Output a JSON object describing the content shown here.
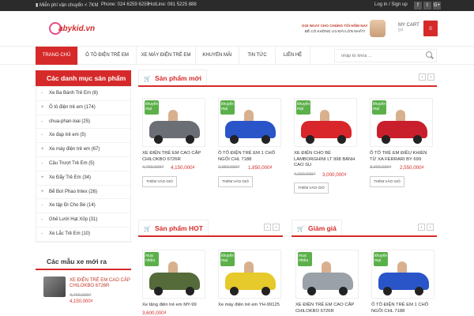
{
  "topbar": {
    "shipping": "Miễn phí vận chuyển < 7KM",
    "phone": "Phone: 024 6259 6259",
    "hotline": "HotLine: 081 5225 888",
    "account": "Log in / Sign up",
    "social": [
      "f",
      "t",
      "G+"
    ]
  },
  "header": {
    "logo_text": "abykid.vn",
    "promo_line1": "GỌI NGAY CHO CHÚNG TÔI HÔM NAY",
    "promo_line2": "ĐỂ CÓ KHÔNG ƯU ĐÃI LỚN NHẤT!",
    "cart_label": "MY CART",
    "cart_amount": "0₫",
    "cart_count": "0"
  },
  "nav": {
    "items": [
      "TRANG CHỦ",
      "Ô TÔ ĐIỆN TRẺ EM",
      "XE MÁY ĐIỆN TRẺ EM",
      "KHUYẾN MÃI",
      "TIN TỨC",
      "LIÊN HỆ"
    ],
    "search_placeholder": "nhập từ khóa ..."
  },
  "sidebar": {
    "categories_title": "Các danh mục sản phẩm",
    "categories": [
      {
        "bullet": "-",
        "label": "Xe Ba Bánh Trẻ Em (6)"
      },
      {
        "bullet": "+",
        "label": "Ô tô điện trẻ em (174)"
      },
      {
        "bullet": "-",
        "label": "chua-phan-loai (25)"
      },
      {
        "bullet": "-",
        "label": "Xe đạp trẻ em (5)"
      },
      {
        "bullet": "+",
        "label": "Xe máy điện trẻ em (67)"
      },
      {
        "bullet": "-",
        "label": "Cầu Trượt Trẻ Em (5)"
      },
      {
        "bullet": "+",
        "label": "Xe Đẩy Trẻ Em (34)"
      },
      {
        "bullet": "+",
        "label": "Bể Bơi Phao Intex (26)"
      },
      {
        "bullet": "-",
        "label": "Xe tập Đi Cho Bé (14)"
      },
      {
        "bullet": "-",
        "label": "Ghế Lười Hạt Xốp (31)"
      },
      {
        "bullet": "-",
        "label": "Xe Lắc Trẻ Em (10)"
      }
    ],
    "models_title": "Các mẫu xe mới ra",
    "model": {
      "name": "XE ĐIỆN TRẺ EM CAO CẤP CHILOKBO 6726R",
      "old_price": "4,700,000₫",
      "price": "4,150,000₫"
    }
  },
  "sections": {
    "new": {
      "title": "Sản phẩm mới",
      "products": [
        {
          "name": "XE ĐIỆN TRẺ EM CAO CẤP CHILOKBO 6726R",
          "old_price": "4,700,000₫",
          "price": "4,150,000₫",
          "badge": "khuyến mại",
          "button": "THÊM VÀO GIỎ",
          "color": "#6b6f75"
        },
        {
          "name": "Ô TÔ ĐIỆN TRẺ EM 1 CHỖ NGỒI CHL 7188",
          "old_price": "2,350,000₫",
          "price": "1,850,000₫",
          "badge": "khuyến mại",
          "button": "THÊM VÀO GIỎ",
          "color": "#2a55c9"
        },
        {
          "name": "XE ĐIỆN CHO BÉ LAMBORGHINI LT 998 BÁNH CAO SU",
          "old_price": "4,200,000₫",
          "price": "3,000,000₫",
          "badge": "khuyến mại",
          "button": "THÊM VÀO GIỎ",
          "color": "#d8262a"
        },
        {
          "name": "Ô TÔ TRẺ EM ĐIỀU KHIỂN TỪ XA FERRARI BY 699",
          "old_price": "3,200,000₫",
          "price": "2,550,000₫",
          "badge": "khuyến mại",
          "button": "THÊM VÀO GIỎ",
          "color": "#c91f2c"
        }
      ]
    },
    "hot": {
      "title": "Sản phẩm HOT",
      "products": [
        {
          "name": "Xe tăng điện trẻ em MY-99",
          "price": "3,600,000₫",
          "badge": "mua nhiều",
          "color": "#556b3a"
        },
        {
          "name": "Xe máy điện trẻ em YH-99125",
          "price": "",
          "badge": "khuyến mại",
          "color": "#e6c92a"
        }
      ]
    },
    "sale": {
      "title": "Giảm giá",
      "products": [
        {
          "name": "XE ĐIỆN TRẺ EM CAO CẤP CHILOKBO 6726R",
          "price": "",
          "badge": "mua nhiều",
          "color": "#9aa1a8"
        },
        {
          "name": "Ô TÔ ĐIỆN TRẺ EM 1 CHỖ NGỒI CHL 7188",
          "price": "",
          "badge": "khuyến mại",
          "color": "#2a55c9"
        }
      ]
    }
  }
}
